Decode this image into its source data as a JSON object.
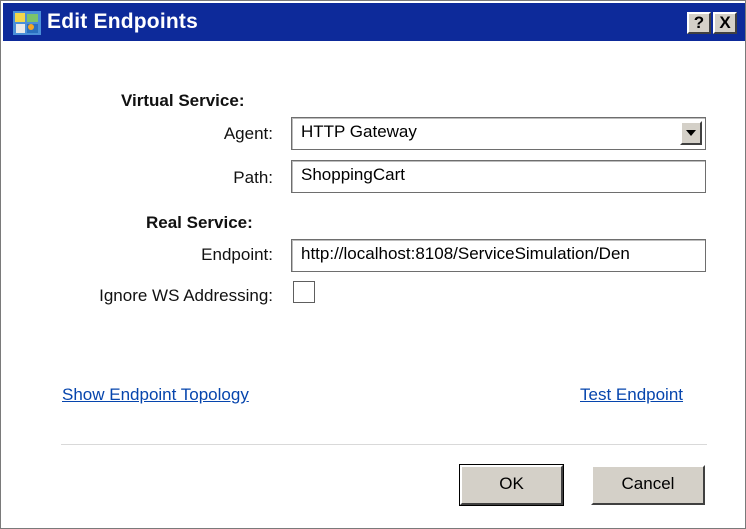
{
  "window": {
    "title": "Edit Endpoints",
    "help_label": "?",
    "close_label": "X"
  },
  "virtual_service": {
    "heading": "Virtual Service:",
    "agent_label": "Agent:",
    "agent_value": "HTTP Gateway",
    "path_label": "Path:",
    "path_value": "ShoppingCart"
  },
  "real_service": {
    "heading": "Real Service:",
    "endpoint_label": "Endpoint:",
    "endpoint_value": "http://localhost:8108/ServiceSimulation/Den",
    "ignore_ws_label": "Ignore WS Addressing:",
    "ignore_ws_checked": false
  },
  "links": {
    "show_topology": "Show Endpoint Topology",
    "test_endpoint": "Test Endpoint"
  },
  "buttons": {
    "ok": "OK",
    "cancel": "Cancel"
  },
  "colors": {
    "title_bar": "#0d2a9a",
    "link": "#0645ad",
    "button_face": "#d4d0c8"
  }
}
